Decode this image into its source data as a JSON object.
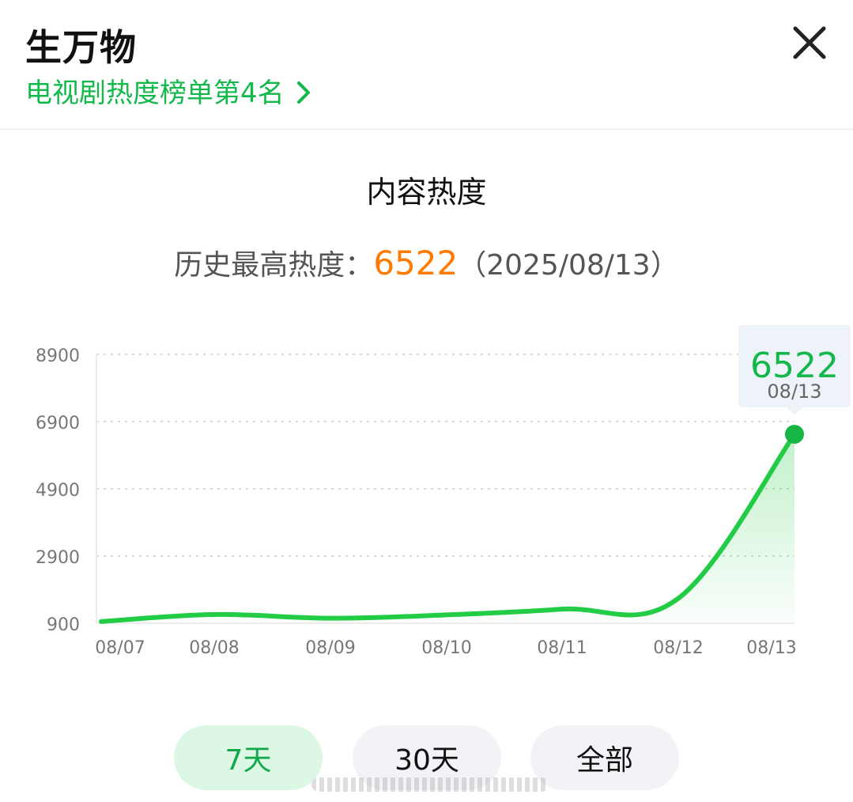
{
  "header": {
    "title": "生万物",
    "rank_text": "电视剧热度榜单第4名"
  },
  "section": {
    "title": "内容热度",
    "peak_label": "历史最高热度：",
    "peak_value": "6522",
    "peak_date": "（2025/08/13）"
  },
  "tooltip": {
    "value": "6522",
    "date": "08/13"
  },
  "colors": {
    "accent": "#12b84a",
    "peak": "#ff7a00",
    "line": "#22cc44"
  },
  "range_buttons": [
    {
      "label": "7天",
      "active": true
    },
    {
      "label": "30天",
      "active": false
    },
    {
      "label": "全部",
      "active": false
    }
  ],
  "chart_data": {
    "type": "area",
    "x": [
      "08/07",
      "08/08",
      "08/09",
      "08/10",
      "08/11",
      "08/12",
      "08/13"
    ],
    "y_ticks": [
      900,
      2900,
      4900,
      6900,
      8900
    ],
    "ylim": [
      900,
      8900
    ],
    "grid": true,
    "series": [
      {
        "values": [
          950,
          1160,
          1050,
          1150,
          1320,
          1640,
          6522
        ]
      }
    ],
    "highlight": {
      "x": "08/13",
      "value": 6522
    }
  }
}
